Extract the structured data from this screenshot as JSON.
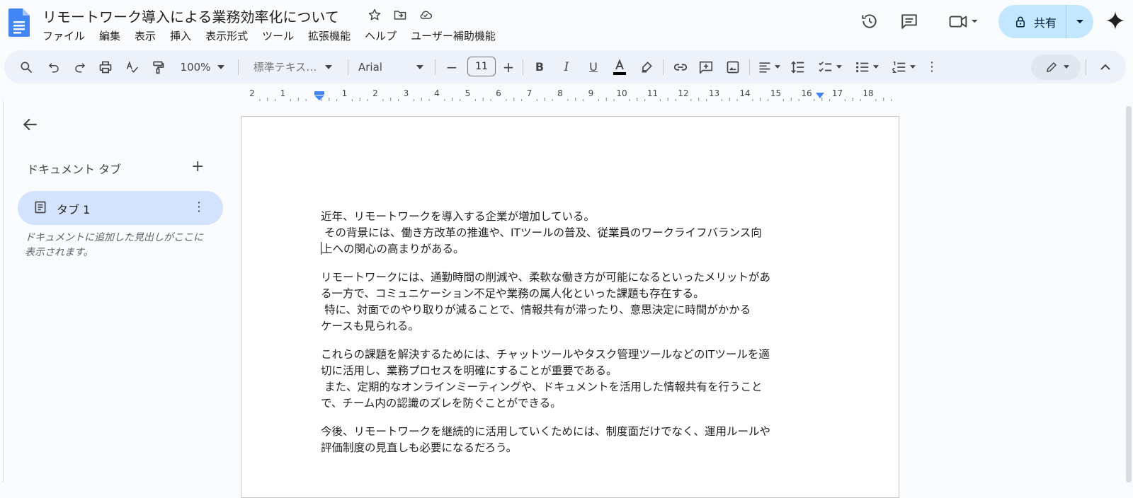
{
  "doc": {
    "title": "リモートワーク導入による業務効率化について"
  },
  "menu": [
    "ファイル",
    "編集",
    "表示",
    "挿入",
    "表示形式",
    "ツール",
    "拡張機能",
    "ヘルプ",
    "ユーザー補助機能"
  ],
  "share": {
    "label": "共有"
  },
  "toolbar": {
    "zoom": "100%",
    "style": "標準テキス…",
    "font": "Arial",
    "font_size": "11"
  },
  "ruler": [
    "2",
    "1",
    "1",
    "2",
    "3",
    "4",
    "5",
    "6",
    "7",
    "8",
    "9",
    "10",
    "11",
    "12",
    "13",
    "14",
    "15",
    "16",
    "17",
    "18"
  ],
  "sidebar": {
    "heading": "ドキュメント タブ",
    "tab_label": "タブ 1",
    "note": "ドキュメントに追加した見出しがここに表示されます。"
  },
  "content": {
    "paragraphs": [
      {
        "lines": [
          "近年、リモートワークを導入する企業が増加している。",
          " その背景には、働き方改革の推進や、ITツールの普及、従業員のワークライフバランス向",
          "上への関心の高まりがある。"
        ]
      },
      {
        "lines": [
          "リモートワークには、通勤時間の削減や、柔軟な働き方が可能になるといったメリットがあ",
          "る一方で、コミュニケーション不足や業務の属人化といった課題も存在する。",
          " 特に、対面でのやり取りが減ることで、情報共有が滞ったり、意思決定に時間がかかる",
          "ケースも見られる。"
        ]
      },
      {
        "lines": [
          "これらの課題を解決するためには、チャットツールやタスク管理ツールなどのITツールを適",
          "切に活用し、業務プロセスを明確にすることが重要である。",
          " また、定期的なオンラインミーティングや、ドキュメントを活用した情報共有を行うこと",
          "で、チーム内の認識のズレを防ぐことができる。"
        ]
      },
      {
        "lines": [
          "今後、リモートワークを継続的に活用していくためには、制度面だけでなく、運用ルールや",
          "評価制度の見直しも必要になるだろう。"
        ]
      }
    ]
  }
}
